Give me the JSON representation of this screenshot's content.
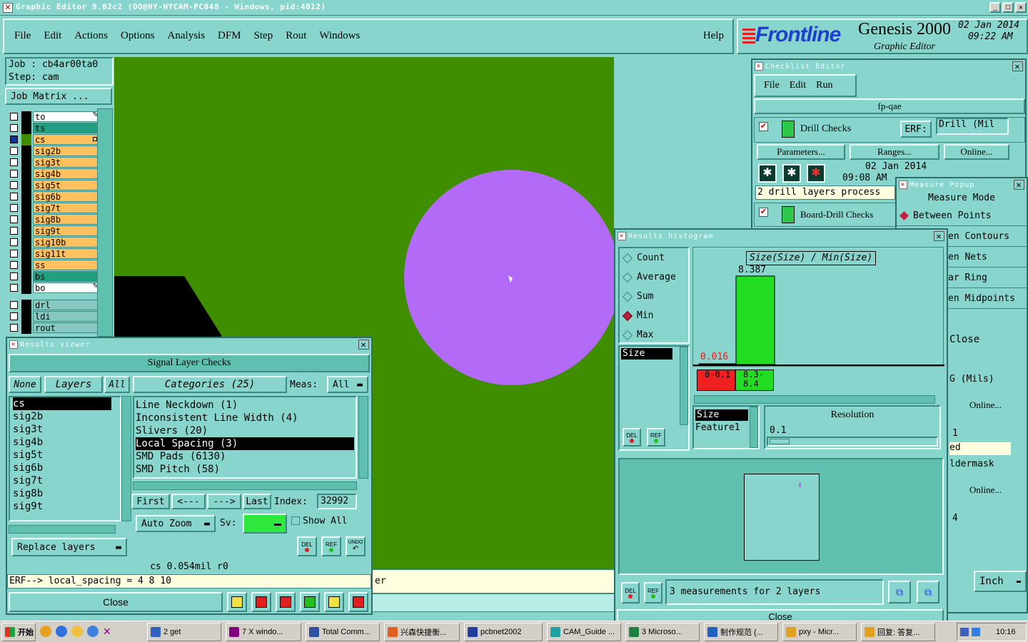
{
  "titlebar": {
    "title": "Graphic Editor 9.02c2  (OO@HY-HYCAM-PC048 - Windows, pid:4012)",
    "buttons": [
      "_",
      "□",
      "×"
    ]
  },
  "menubar": {
    "items": [
      "File",
      "Edit",
      "Actions",
      "Options",
      "Analysis",
      "DFM",
      "Step",
      "Rout",
      "Windows"
    ],
    "help": "Help"
  },
  "brand": {
    "logo": "Frontline",
    "product": "Genesis 2000",
    "subtitle": "Graphic Editor",
    "date": "02 Jan 2014",
    "time": "09:22 AM"
  },
  "jobpanel": {
    "job": "Job : cb4ar00ta0",
    "step": "Step: cam",
    "matrix_button": "Job Matrix ..."
  },
  "layers": [
    {
      "name": "to",
      "color": "#FFFFFF",
      "mark": "pencil"
    },
    {
      "name": "ts",
      "color": "#20A080"
    },
    {
      "name": "cs",
      "color": "#FFC060",
      "mark": "square",
      "active": true
    },
    {
      "name": "sig2b",
      "color": "#FFC060"
    },
    {
      "name": "sig3t",
      "color": "#FFC060"
    },
    {
      "name": "sig4b",
      "color": "#FFC060"
    },
    {
      "name": "sig5t",
      "color": "#FFC060"
    },
    {
      "name": "sig6b",
      "color": "#FFC060"
    },
    {
      "name": "sig7t",
      "color": "#FFC060"
    },
    {
      "name": "sig8b",
      "color": "#FFC060"
    },
    {
      "name": "sig9t",
      "color": "#FFC060"
    },
    {
      "name": "sig10b",
      "color": "#FFC060"
    },
    {
      "name": "sig11t",
      "color": "#FFC060"
    },
    {
      "name": "ss",
      "color": "#FFC060"
    },
    {
      "name": "bs",
      "color": "#20A080"
    },
    {
      "name": "bo",
      "color": "#FFFFFF",
      "mark": "pencil"
    }
  ],
  "layers2": [
    {
      "name": "drl"
    },
    {
      "name": "ldi"
    },
    {
      "name": "rout"
    }
  ],
  "canvas": {
    "background": "#3F8E00",
    "pad_color": "#B36AF7"
  },
  "results_viewer": {
    "title": "Results viewer",
    "header": "Signal Layer Checks",
    "tabs": {
      "none": "None",
      "layers": "Layers",
      "all": "All"
    },
    "categories_label": "Categories (25)",
    "meas_label": "Meas:",
    "meas_value": "All",
    "layer_list": [
      "cs",
      "sig2b",
      "sig3t",
      "sig4b",
      "sig5t",
      "sig6b",
      "sig7t",
      "sig8b",
      "sig9t"
    ],
    "categories": [
      "Line Neckdown (1)",
      "Inconsistent Line Width (4)",
      "Slivers (20)",
      "Local Spacing (3)",
      "SMD Pads (6130)",
      "SMD Pitch (58)"
    ],
    "selected_category": "Local Spacing (3)",
    "nav": {
      "first": "First",
      "prev": "<---",
      "next": "--->",
      "last": "Last",
      "index_label": "Index:",
      "index_value": "32992"
    },
    "auto_zoom": "Auto Zoom",
    "sv_label": "Sv:",
    "show_all": "Show All",
    "replace": "Replace layers",
    "small_buttons": [
      "DEL",
      "REF",
      "UNDO"
    ],
    "status": "cs 0.054mil  r0",
    "erf": "ERF--> local_spacing = 4 8 10",
    "close": "Close"
  },
  "histogram": {
    "title": "Results histogram",
    "chart_title": "Size(Size) / Min(Size)",
    "modes": [
      "Count",
      "Average",
      "Sum",
      "Min",
      "Max"
    ],
    "selected_mode": "Min",
    "list_item": "Size",
    "field_label": "Size",
    "field2": "Feature1",
    "resolution_label": "Resolution",
    "resolution_value": "0.1",
    "small_buttons": [
      "DEL",
      "REF"
    ],
    "status": "3 measurements for 2 layers",
    "close": "Close"
  },
  "chart_data": {
    "type": "bar",
    "title": "Size(Size) / Min(Size)",
    "categories": [
      "0-0.1",
      "8.3-8.4"
    ],
    "values": [
      0.016,
      8.387
    ],
    "colors": [
      "#F02020",
      "#22DD22"
    ]
  },
  "checklist": {
    "title": "Checklist Editor",
    "menu": [
      "File",
      "Edit",
      "Run"
    ],
    "name": "fp-qae",
    "item1": {
      "label": "Drill Checks",
      "erf": "ERF:",
      "erf_value": "Drill (Mil"
    },
    "buttons": [
      "Parameters...",
      "Ranges...",
      "Online..."
    ],
    "date": "02 Jan 2014",
    "time": "09:08 AM",
    "status": "2 drill layers process",
    "item2": {
      "label": "Board-Drill Checks"
    },
    "right_frag": [
      "G (Mils)",
      "Online...",
      "1",
      "ed",
      "ldermask",
      "Online...",
      "4"
    ]
  },
  "measure": {
    "title": "Measure Popup",
    "mode_label": "Measure Mode",
    "options": [
      "Between Points",
      "en Contours",
      "en Nets",
      "ar Ring",
      "en Midpoints"
    ],
    "close": "Close",
    "unit": "Inch"
  },
  "canvas_status": "er",
  "taskbar": {
    "start": "开始",
    "items": [
      "2 get",
      "7 X windo...",
      "Total Comm...",
      "兴森快捷衡...",
      "pcbnet2002",
      "CAM_Guide ...",
      "3 Microso...",
      "制作规范 (...",
      "pxy - Micr...",
      "回复: 答复..."
    ],
    "clock": "10:16"
  }
}
